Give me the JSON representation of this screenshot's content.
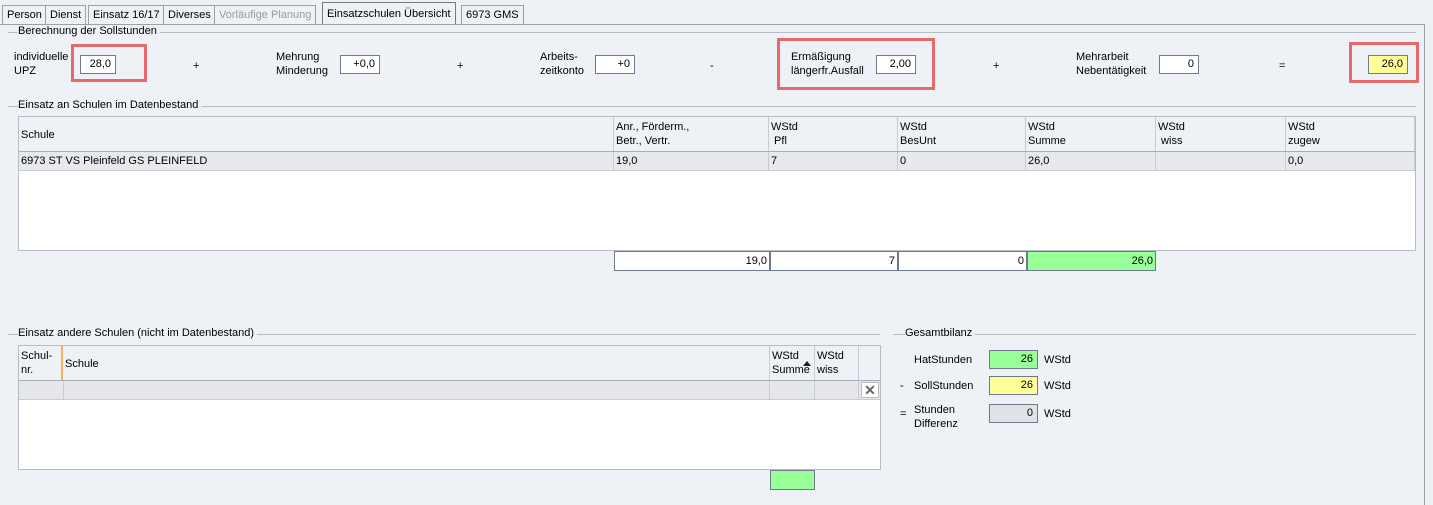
{
  "tabs": [
    "Person",
    "Dienst",
    "Einsatz 16/17",
    "Diverses",
    "Vorläufige Planung",
    "Einsatzschulen Übersicht",
    "6973 GMS"
  ],
  "soll": {
    "group_title": "Berechnung der Sollstunden",
    "upz_label_1": "individuelle",
    "upz_label_2": "UPZ",
    "upz_value": "28,0",
    "plus1": "+",
    "mehrung_label_1": "Mehrung",
    "mehrung_label_2": "Minderung",
    "mehrung_value": "+0,0",
    "plus2": "+",
    "konto_label_1": "Arbeits-",
    "konto_label_2": "zeitkonto",
    "konto_value": "+0",
    "minus": "-",
    "erm_label_1": "Ermäßigung",
    "erm_label_2": "längerfr.Ausfall",
    "erm_value": "2,00",
    "plus3": "+",
    "mehr_label_1": "Mehrarbeit",
    "mehr_label_2": "Nebentätigkeit",
    "mehr_value": "0",
    "equals": "=",
    "result_value": "26,0"
  },
  "einsatz": {
    "group_title": "Einsatz an Schulen im Datenbestand",
    "headers": [
      [
        "Schule",
        ""
      ],
      [
        "Anr., Förderm.,",
        "Betr., Vertr."
      ],
      [
        "WStd",
        " Pfl"
      ],
      [
        "WStd",
        "BesUnt"
      ],
      [
        "WStd",
        "Summe"
      ],
      [
        "WStd",
        " wiss"
      ],
      [
        "WStd",
        "zugew"
      ]
    ],
    "rows": [
      [
        "6973 ST VS Pleinfeld GS PLEINFELD",
        "19,0",
        "7",
        "0",
        "26,0",
        "",
        "0,0"
      ]
    ],
    "sums": [
      "19,0",
      "7",
      "0",
      "26,0"
    ]
  },
  "andere": {
    "group_title": "Einsatz andere Schulen (nicht im Datenbestand)",
    "h_nr_1": "Schul-",
    "h_nr_2": "nr.",
    "h_schule": "Schule",
    "h_summe_1": "WStd",
    "h_summe_2": "Summe",
    "h_wiss_1": "WStd",
    "h_wiss_2": "wiss",
    "sum_value": ""
  },
  "bilanz": {
    "group_title": "Gesamtbilanz",
    "hat_label": "HatStunden",
    "hat_value": "26",
    "soll_prefix": "-",
    "soll_label": "SollStunden",
    "soll_value": "26",
    "diff_prefix": "=",
    "diff_label_1": "Stunden",
    "diff_label_2": "Differenz",
    "diff_value": "0",
    "unit": "WStd"
  },
  "colors": {
    "highlight": "#e56b6b",
    "yellow": "#ffff99",
    "green": "#99ff99"
  }
}
